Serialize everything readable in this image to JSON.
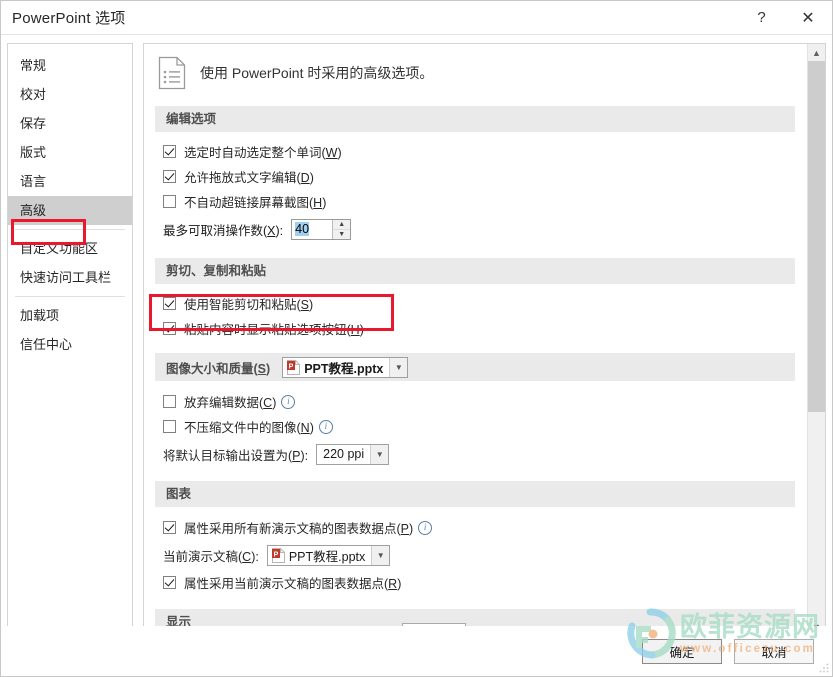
{
  "window": {
    "title": "PowerPoint 选项",
    "help_label": "?",
    "close_label": "✕"
  },
  "sidebar": {
    "items": [
      {
        "label": "常规",
        "selected": false
      },
      {
        "label": "校对",
        "selected": false
      },
      {
        "label": "保存",
        "selected": false
      },
      {
        "label": "版式",
        "selected": false
      },
      {
        "label": "语言",
        "selected": false
      },
      {
        "label": "高级",
        "selected": true
      },
      {
        "label": "自定义功能区",
        "selected": false
      },
      {
        "label": "快速访问工具栏",
        "selected": false
      },
      {
        "label": "加载项",
        "selected": false
      },
      {
        "label": "信任中心",
        "selected": false
      }
    ]
  },
  "pane": {
    "header_text": "使用 PowerPoint 时采用的高级选项。",
    "sections": {
      "editing": {
        "title": "编辑选项",
        "options": [
          {
            "label": "选定时自动选定整个单词(",
            "accel": "W",
            "tail": ")",
            "checked": true
          },
          {
            "label": "允许拖放式文字编辑(",
            "accel": "D",
            "tail": ")",
            "checked": true
          },
          {
            "label": "不自动超链接屏幕截图(",
            "accel": "H",
            "tail": ")",
            "checked": false
          }
        ],
        "undo": {
          "label": "最多可取消操作数(",
          "accel": "X",
          "tail": "):",
          "value": "40"
        }
      },
      "clipboard": {
        "title": "剪切、复制和粘贴",
        "options": [
          {
            "label": "使用智能剪切和粘贴(",
            "accel": "S",
            "tail": ")",
            "checked": true
          },
          {
            "label": "粘贴内容时显示粘贴选项按钮(",
            "accel": "H",
            "tail": ")",
            "checked": true
          }
        ]
      },
      "image": {
        "title": "图像大小和质量(",
        "title_accel": "S",
        "title_tail": ")",
        "file": "PPT教程.pptx",
        "options": [
          {
            "label": "放弃编辑数据(",
            "accel": "C",
            "tail": ")",
            "checked": false,
            "info": true
          },
          {
            "label": "不压缩文件中的图像(",
            "accel": "N",
            "tail": ")",
            "checked": false,
            "info": true
          }
        ],
        "ppi": {
          "label": "将默认目标输出设置为(",
          "accel": "P",
          "tail": "):",
          "value": "220 ppi"
        }
      },
      "chart": {
        "title": "图表",
        "option_new": {
          "label": "属性采用所有新演示文稿的图表数据点(",
          "accel": "P",
          "tail": ")",
          "checked": true,
          "info": true
        },
        "current": {
          "label": "当前演示文稿(",
          "accel": "C",
          "tail": "):",
          "file": "PPT教程.pptx"
        },
        "option_current": {
          "label": "属性采用当前演示文稿的图表数据点(",
          "accel": "R",
          "tail": ")",
          "checked": true
        }
      },
      "display": {
        "title": "显示"
      }
    }
  },
  "footer": {
    "ok_label": "确定",
    "cancel_label": "取消"
  },
  "watermark": {
    "text_cn": "欧菲资源网",
    "text_url": "www.officezu.com"
  },
  "colors": {
    "annotation": "#e8192c",
    "selection": "#9fd0f0",
    "section_bar": "#eaeaea",
    "nav_selected": "#cfcfcf",
    "ppt_icon": "#c0392b",
    "watermark_cn": "#a5dcc4",
    "watermark_url": "#f2b07a"
  }
}
